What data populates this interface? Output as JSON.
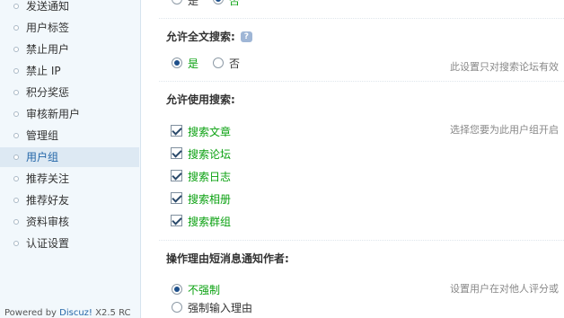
{
  "sidebar": {
    "items": [
      {
        "label": "发送通知"
      },
      {
        "label": "用户标签"
      },
      {
        "label": "禁止用户"
      },
      {
        "label": "禁止 IP"
      },
      {
        "label": "积分奖惩"
      },
      {
        "label": "审核新用户"
      },
      {
        "label": "管理组"
      },
      {
        "label": "用户组"
      },
      {
        "label": "推荐关注"
      },
      {
        "label": "推荐好友"
      },
      {
        "label": "资料审核"
      },
      {
        "label": "认证设置"
      }
    ],
    "active_item": "用户组",
    "footer": {
      "prefix": "Powered by",
      "brand": "Discuz!",
      "version": "X2.5 RC"
    }
  },
  "settings": {
    "top_partial": {
      "yes": "是",
      "no": "否"
    },
    "fulltext_search": {
      "label": "允许全文搜索:",
      "help_icon": "?",
      "yes": "是",
      "no": "否",
      "selected": "是",
      "description": "此设置只对搜索论坛有效"
    },
    "allow_search": {
      "label": "允许使用搜索:",
      "description": "选择您要为此用户组开启",
      "options": [
        {
          "label": "搜索文章",
          "checked": true
        },
        {
          "label": "搜索论坛",
          "checked": true
        },
        {
          "label": "搜索日志",
          "checked": true
        },
        {
          "label": "搜索相册",
          "checked": true
        },
        {
          "label": "搜索群组",
          "checked": true
        }
      ]
    },
    "notify_author": {
      "label": "操作理由短消息通知作者:",
      "description": "设置用户在对他人评分或",
      "options": [
        {
          "label": "不强制",
          "selected": true
        },
        {
          "label": "强制输入理由",
          "selected": false
        }
      ]
    }
  },
  "colors": {
    "accent": "#2366a8",
    "selected_option": "#0aa110",
    "sidebar_bg": "#f2f8fc"
  }
}
